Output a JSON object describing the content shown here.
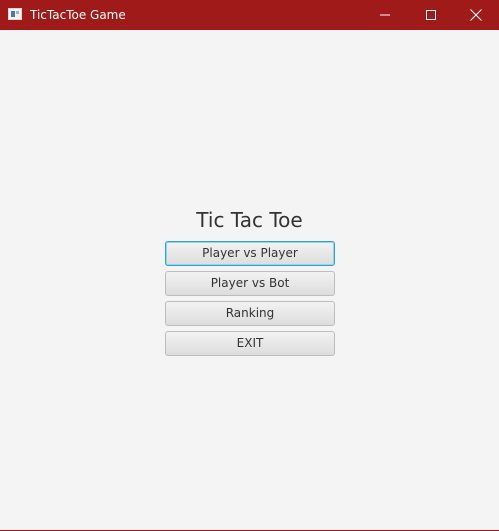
{
  "window": {
    "title": "TicTacToe Game",
    "titlebar_color": "#a11a1a",
    "controls": {
      "minimize_icon": "minimize-icon",
      "maximize_icon": "maximize-icon",
      "close_icon": "close-icon"
    }
  },
  "main": {
    "title": "Tic Tac Toe",
    "buttons": [
      {
        "label": "Player vs Player",
        "focused": true
      },
      {
        "label": "Player vs Bot",
        "focused": false
      },
      {
        "label": "Ranking",
        "focused": false
      },
      {
        "label": "EXIT",
        "focused": false
      }
    ],
    "focus_color": "#2f9fd8"
  }
}
